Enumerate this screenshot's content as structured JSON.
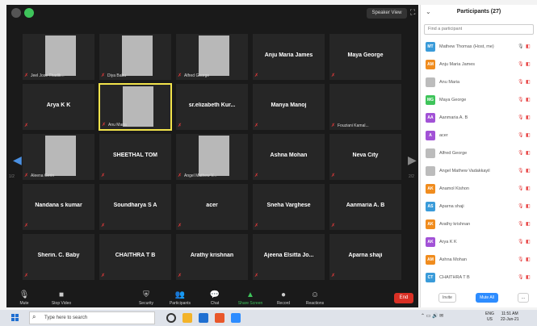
{
  "topbar": {
    "view_button": "Speaker View"
  },
  "grid": {
    "tiles": [
      {
        "name": "",
        "label": "Jeel Jose Thadik...",
        "video": true,
        "row": 0,
        "col": 0
      },
      {
        "name": "",
        "label": "Diya Babu",
        "video": true,
        "row": 0,
        "col": 1
      },
      {
        "name": "",
        "label": "Alfred George",
        "video": true,
        "row": 0,
        "col": 2
      },
      {
        "name": "Anju Maria James",
        "label": "",
        "video": false,
        "row": 0,
        "col": 3
      },
      {
        "name": "Maya George",
        "label": "",
        "video": false,
        "row": 0,
        "col": 4
      },
      {
        "name": "Arya K K",
        "label": "",
        "video": false,
        "row": 1,
        "col": 0
      },
      {
        "name": "",
        "label": "Anu Maria",
        "video": true,
        "row": 1,
        "col": 1,
        "active": true
      },
      {
        "name": "sr.elizabeth Kur...",
        "label": "",
        "video": false,
        "row": 1,
        "col": 2
      },
      {
        "name": "Manya Manoj",
        "label": "",
        "video": false,
        "row": 1,
        "col": 3
      },
      {
        "name": "",
        "label": "Fouziani Kamal...",
        "video": false,
        "row": 1,
        "col": 4
      },
      {
        "name": "",
        "label": "Aleena Gerin",
        "video": true,
        "row": 2,
        "col": 0
      },
      {
        "name": "SHEETHAL TOM",
        "label": "",
        "video": false,
        "row": 2,
        "col": 1
      },
      {
        "name": "",
        "label": "Angel Mathew V...",
        "video": true,
        "row": 2,
        "col": 2
      },
      {
        "name": "Ashna Mohan",
        "label": "",
        "video": false,
        "row": 2,
        "col": 3
      },
      {
        "name": "Neva City",
        "label": "",
        "video": false,
        "row": 2,
        "col": 4
      },
      {
        "name": "Nandana s kumar",
        "label": "",
        "video": false,
        "row": 3,
        "col": 0
      },
      {
        "name": "Soundharya S A",
        "label": "",
        "video": false,
        "row": 3,
        "col": 1
      },
      {
        "name": "acer",
        "label": "",
        "video": false,
        "row": 3,
        "col": 2
      },
      {
        "name": "Sneha Varghese",
        "label": "",
        "video": false,
        "row": 3,
        "col": 3
      },
      {
        "name": "Aanmaria A. B",
        "label": "",
        "video": false,
        "row": 3,
        "col": 4
      },
      {
        "name": "Sherin. C. Baby",
        "label": "",
        "video": false,
        "row": 4,
        "col": 0
      },
      {
        "name": "CHAITHRA T B",
        "label": "",
        "video": false,
        "row": 4,
        "col": 1
      },
      {
        "name": "Arathy krishnan",
        "label": "",
        "video": false,
        "row": 4,
        "col": 2
      },
      {
        "name": "Ajeena Elsitta Jo...",
        "label": "",
        "video": false,
        "row": 4,
        "col": 3
      },
      {
        "name": "Aparna shaji",
        "label": "",
        "video": false,
        "row": 4,
        "col": 4
      }
    ],
    "page_left": "1/2",
    "page_right": "2/2"
  },
  "toolbar": {
    "mute": "Mute",
    "stop_video": "Stop Video",
    "security": "Security",
    "participants": "Participants",
    "participants_count": "27",
    "chat": "Chat",
    "share_screen": "Share Screen",
    "record": "Record",
    "reactions": "Reactions",
    "end": "End"
  },
  "panel": {
    "title": "Participants (27)",
    "search_placeholder": "Find a participant",
    "participants": [
      {
        "initials": "MT",
        "name": "Mathew Thomas (Host, me)",
        "color": "#3a9bd9"
      },
      {
        "initials": "AM",
        "name": "Anju Maria James",
        "color": "#f08c1e"
      },
      {
        "initials": "",
        "name": "Anu Maria",
        "color": "#bcbcbc"
      },
      {
        "initials": "MG",
        "name": "Maya George",
        "color": "#3ec45a"
      },
      {
        "initials": "AA",
        "name": "Aanmaria A. B",
        "color": "#a252d6"
      },
      {
        "initials": "A",
        "name": "acer",
        "color": "#a252d6"
      },
      {
        "initials": "",
        "name": "Alfred George",
        "color": "#bcbcbc"
      },
      {
        "initials": "",
        "name": "Angel Mathew Vadakkayil",
        "color": "#bcbcbc"
      },
      {
        "initials": "AK",
        "name": "Anamol Kishon",
        "color": "#f08c1e"
      },
      {
        "initials": "AS",
        "name": "Aparna shaji",
        "color": "#3a9bd9"
      },
      {
        "initials": "AK",
        "name": "Arathy krishnan",
        "color": "#f08c1e"
      },
      {
        "initials": "AK",
        "name": "Arya K K",
        "color": "#a252d6"
      },
      {
        "initials": "AM",
        "name": "Ashna Mohan",
        "color": "#f08c1e"
      },
      {
        "initials": "CT",
        "name": "CHAITHRA T B",
        "color": "#3a9bd9"
      }
    ],
    "invite": "Invite",
    "mute_all": "Mute All",
    "more": "..."
  },
  "taskbar": {
    "search_placeholder": "Type here to search",
    "lang_line1": "ENG",
    "lang_line2": "US",
    "time": "11:51 AM",
    "date": "22-Jun-21"
  }
}
